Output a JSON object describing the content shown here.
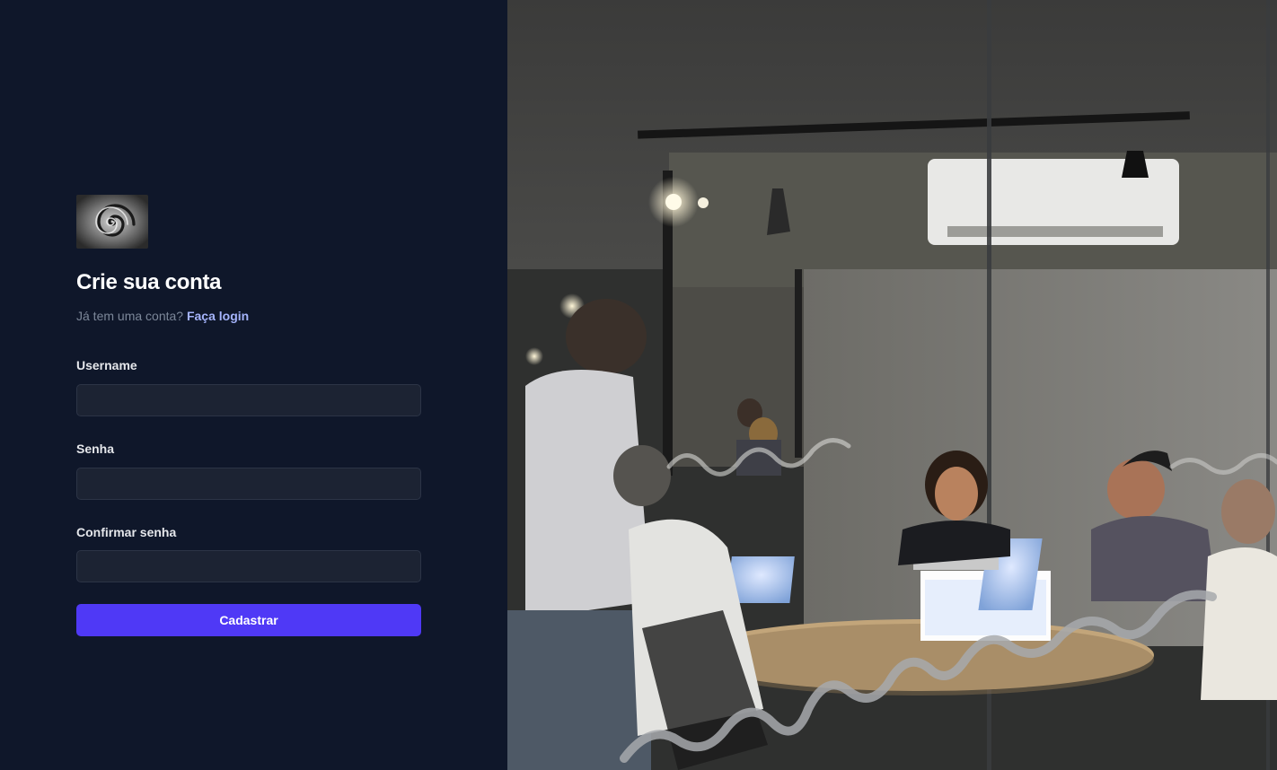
{
  "form": {
    "title": "Crie sua conta",
    "subtitle_text": "Já tem uma conta?",
    "login_link": "Faça login",
    "fields": [
      {
        "label": "Username",
        "value": "",
        "type": "text"
      },
      {
        "label": "Senha",
        "value": "",
        "type": "password"
      },
      {
        "label": "Confirmar senha",
        "value": "",
        "type": "password"
      }
    ],
    "submit_label": "Cadastrar"
  },
  "colors": {
    "background": "#0f172a",
    "input_bg": "#1c2333",
    "accent": "#4f39f6",
    "link": "#a5b4fc"
  },
  "hero": {
    "icon": "office-meeting-photo"
  }
}
